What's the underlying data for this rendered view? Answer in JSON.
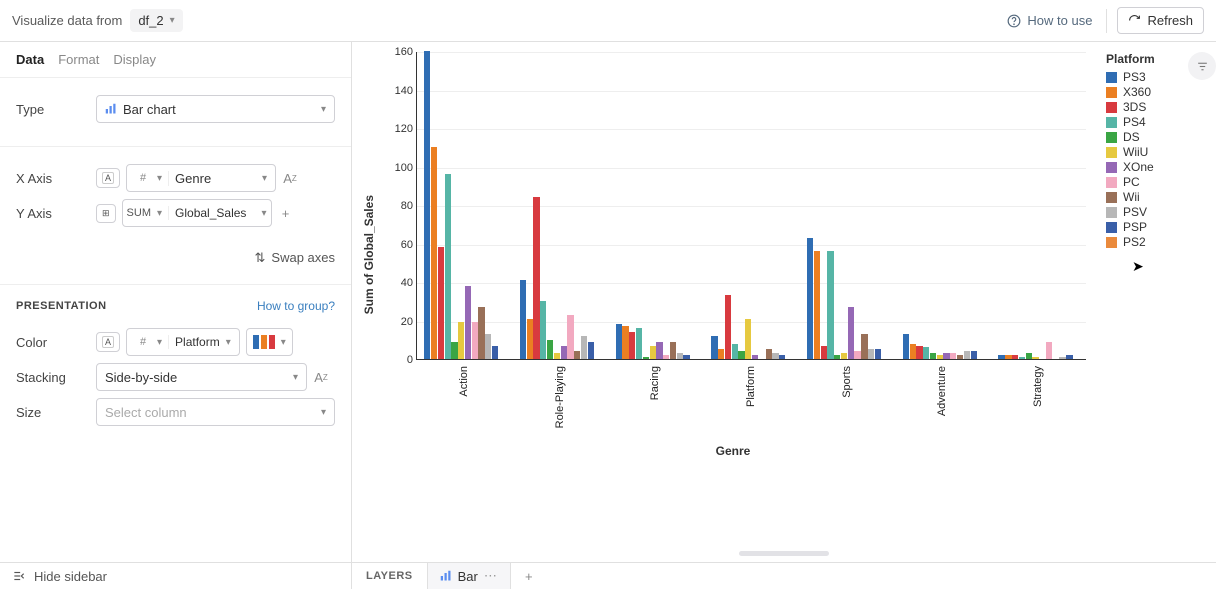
{
  "topbar": {
    "title_prefix": "Visualize data from",
    "dataframe": "df_2",
    "how_to_use": "How to use",
    "refresh": "Refresh"
  },
  "tabs": {
    "data": "Data",
    "format": "Format",
    "display": "Display"
  },
  "sidebar": {
    "type_label": "Type",
    "type_value": "Bar chart",
    "xaxis_label": "X Axis",
    "xaxis_agg": "#",
    "xaxis_value": "Genre",
    "yaxis_label": "Y Axis",
    "yaxis_agg": "SUM",
    "yaxis_value": "Global_Sales",
    "swap": "Swap axes",
    "presentation": "PRESENTATION",
    "how_group": "How to group?",
    "color_label": "Color",
    "color_agg": "#",
    "color_value": "Platform",
    "stacking_label": "Stacking",
    "stacking_value": "Side-by-side",
    "size_label": "Size",
    "size_placeholder": "Select column"
  },
  "bottom": {
    "hide": "Hide sidebar",
    "layers": "LAYERS",
    "bar_tab": "Bar"
  },
  "legend_title": "Platform",
  "chart_data": {
    "type": "bar",
    "title": "",
    "xlabel": "Genre",
    "ylabel": "Sum of Global_Sales",
    "ylim": [
      0,
      160
    ],
    "yticks": [
      0,
      20,
      40,
      60,
      80,
      100,
      120,
      140,
      160
    ],
    "categories": [
      "Action",
      "Role-Playing",
      "Racing",
      "Platform",
      "Sports",
      "Adventure",
      "Strategy"
    ],
    "series": [
      {
        "name": "PS3",
        "color": "#2f6db3",
        "values": [
          160,
          41,
          18,
          12,
          63,
          13,
          2
        ]
      },
      {
        "name": "X360",
        "color": "#eb7f22",
        "values": [
          110,
          21,
          17,
          5,
          56,
          8,
          2
        ]
      },
      {
        "name": "3DS",
        "color": "#d83a3f",
        "values": [
          58,
          84,
          14,
          33,
          7,
          7,
          2
        ]
      },
      {
        "name": "PS4",
        "color": "#56b5a6",
        "values": [
          96,
          30,
          16,
          8,
          56,
          6,
          1
        ]
      },
      {
        "name": "DS",
        "color": "#3aa544",
        "values": [
          9,
          10,
          1,
          4,
          2,
          3,
          3
        ]
      },
      {
        "name": "WiiU",
        "color": "#e6c940",
        "values": [
          19,
          3,
          7,
          21,
          3,
          2,
          1
        ]
      },
      {
        "name": "XOne",
        "color": "#9568b5",
        "values": [
          38,
          7,
          9,
          2,
          27,
          3,
          0
        ]
      },
      {
        "name": "PC",
        "color": "#f2a9c0",
        "values": [
          19,
          23,
          2,
          0,
          4,
          3,
          9
        ]
      },
      {
        "name": "Wii",
        "color": "#997058",
        "values": [
          27,
          4,
          9,
          5,
          13,
          2,
          0
        ]
      },
      {
        "name": "PSV",
        "color": "#b7b7b7",
        "values": [
          13,
          12,
          3,
          3,
          5,
          4,
          1
        ]
      },
      {
        "name": "PSP",
        "color": "#3a5fa8",
        "values": [
          7,
          9,
          2,
          2,
          5,
          4,
          2
        ]
      },
      {
        "name": "PS2",
        "color": "#ea8a3c",
        "values": [
          0,
          0,
          0,
          0,
          0,
          0,
          0
        ]
      }
    ]
  }
}
